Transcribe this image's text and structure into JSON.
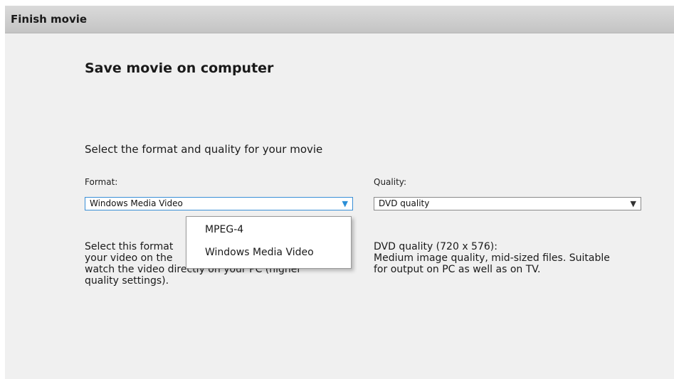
{
  "window": {
    "title": "Finish movie"
  },
  "main": {
    "heading": "Save movie on computer",
    "instruction": "Select the format and quality for your movie"
  },
  "format": {
    "label": "Format:",
    "selected": "Windows Media Video",
    "arrow_icon": "▼",
    "description": "Select this format if you want to play back your video on the Xbox 360 or (if you only) watch the video directly on your PC (higher quality settings).",
    "description_lines": [
      "Select this format",
      "your video on the",
      "watch the video directly on your PC (higher",
      "quality settings)."
    ],
    "options": [
      "MPEG-4",
      "Windows Media Video"
    ]
  },
  "quality": {
    "label": "Quality:",
    "selected": "DVD quality",
    "arrow_icon": "▼",
    "description_lines": [
      "DVD quality (720 x 576):",
      "Medium image quality, mid-sized files. Suitable",
      "for output on PC as well as on TV."
    ]
  },
  "colors": {
    "titlebar": "#c8c8c8",
    "background": "#f0f0f0",
    "accent": "#2a8fd8"
  }
}
